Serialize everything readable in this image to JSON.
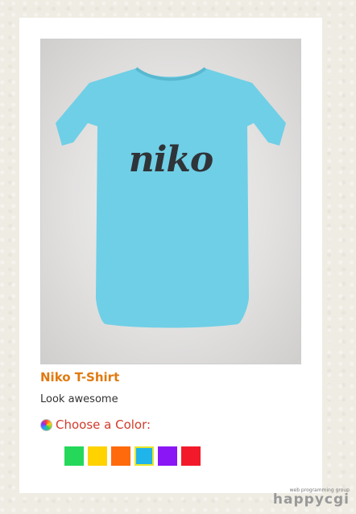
{
  "product": {
    "title": "Niko T-Shirt",
    "description": "Look awesome",
    "shirt_text": "niko",
    "shirt_color": "#6fcfe6"
  },
  "color_picker": {
    "label": "Choose a Color:",
    "icon": "color-wheel-icon",
    "swatches": [
      {
        "name": "green",
        "color": "#25d85a",
        "selected": false
      },
      {
        "name": "yellow",
        "color": "#ffd200",
        "selected": false
      },
      {
        "name": "orange",
        "color": "#ff6a0d",
        "selected": false
      },
      {
        "name": "blue",
        "color": "#1fb4ea",
        "selected": true
      },
      {
        "name": "purple",
        "color": "#8a16f5",
        "selected": false
      },
      {
        "name": "red",
        "color": "#f21a2a",
        "selected": false
      }
    ]
  },
  "watermark": {
    "small_text": "web programming group",
    "brand": "happycgi"
  }
}
